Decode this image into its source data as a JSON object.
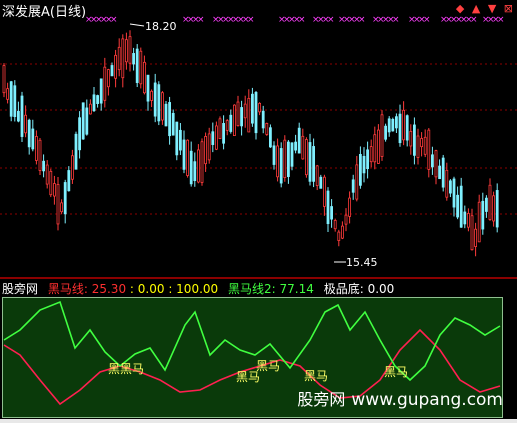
{
  "window": {
    "title": "深发展A(日线)",
    "icons": [
      "diamond-icon",
      "up-arrow-icon",
      "down-arrow-icon",
      "close-icon"
    ]
  },
  "main_chart": {
    "high_label": "18.20",
    "low_label": "15.45",
    "signal_marker": "×",
    "colors": {
      "up": "#ff3b3b",
      "down": "#7ff0ff",
      "signal": "#ff40ff",
      "grid": "#8b0000"
    }
  },
  "indicator": {
    "name": "股旁网",
    "values": [
      {
        "label": "黑马线:",
        "value": "25.30",
        "color": "#ff3030"
      },
      {
        "label": "",
        "value": ": 0.00",
        "color": "#ffff00"
      },
      {
        "label": "",
        "value": ": 100.00",
        "color": "#ffff00"
      },
      {
        "label": "黑马线2:",
        "value": "77.14",
        "color": "#40ff40"
      },
      {
        "label": "极品底:",
        "value": "0.00",
        "color": "#ffffff"
      }
    ],
    "signal_labels": [
      "黑黑马",
      "黑马",
      "黑马",
      "黑马",
      "黑马"
    ],
    "colors": {
      "line1": "#ff2050",
      "line2": "#40ff40",
      "background": "#0a3a0a"
    }
  },
  "watermark": {
    "brand": "股旁网",
    "url": "www.gupang.com"
  }
}
